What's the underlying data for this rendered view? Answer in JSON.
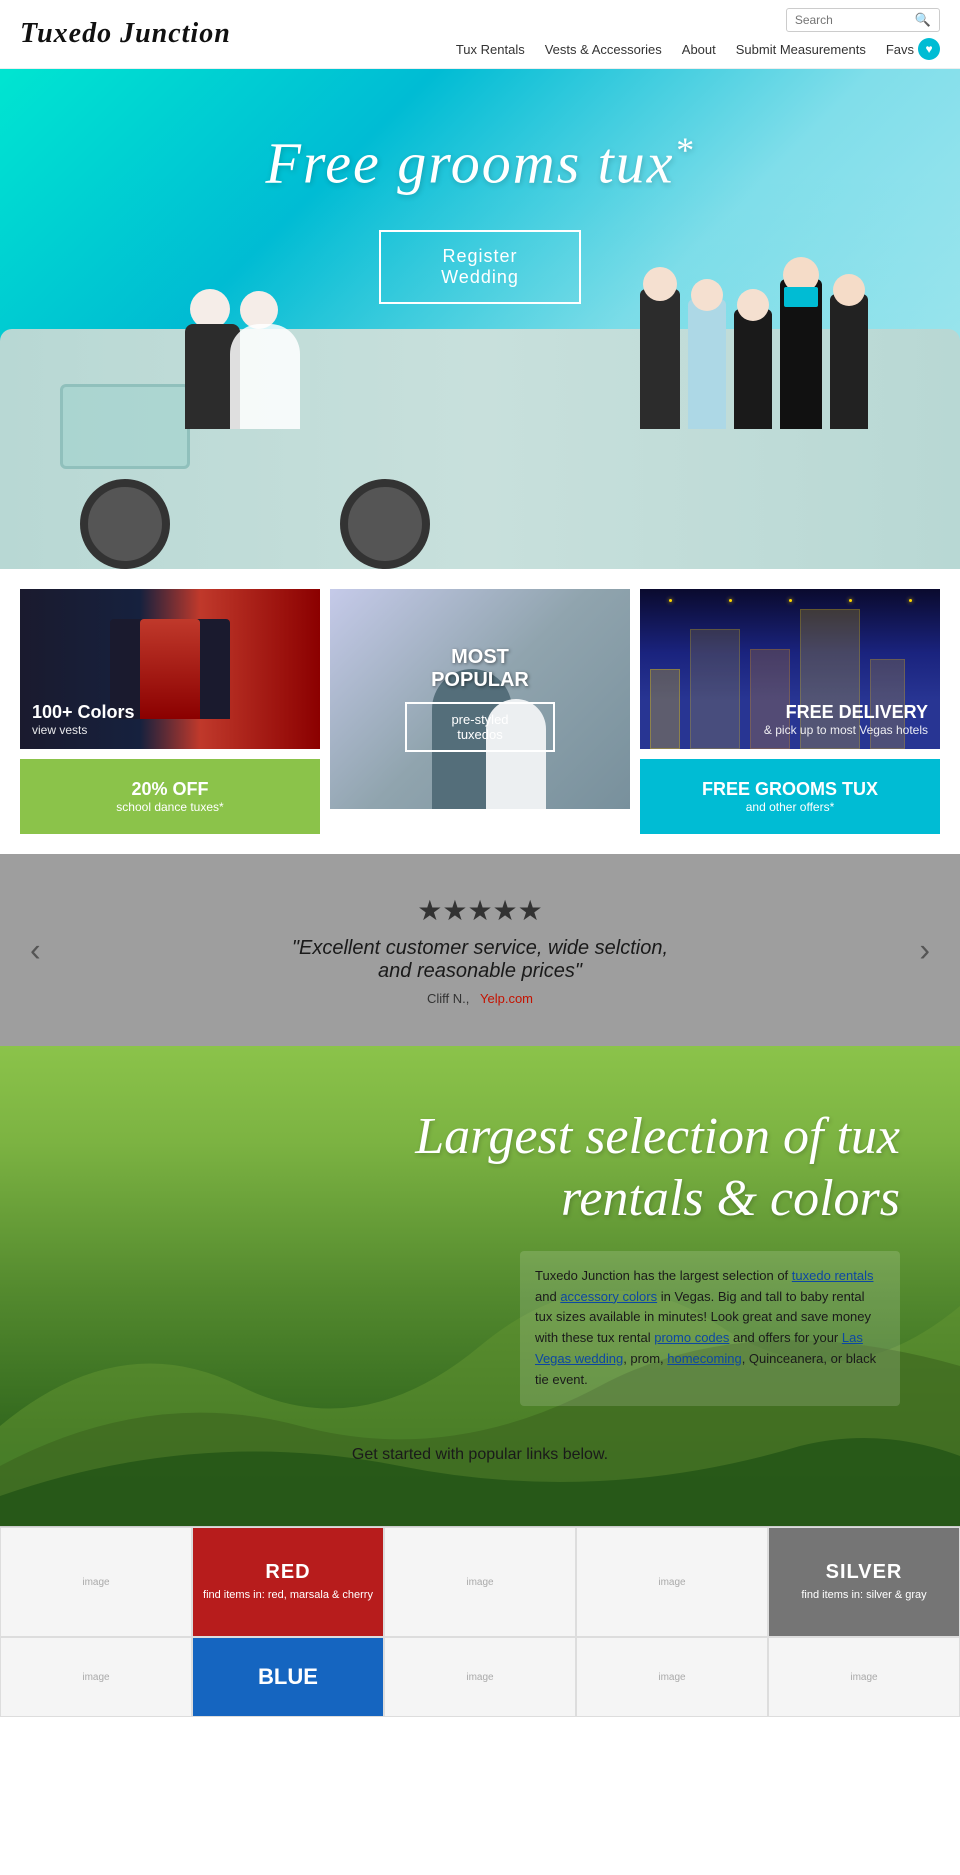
{
  "header": {
    "logo": "Tuxedo Junction",
    "search_placeholder": "Search",
    "nav": [
      {
        "label": "Tux Rentals",
        "href": "#"
      },
      {
        "label": "Vests & Accessories",
        "href": "#"
      },
      {
        "label": "About",
        "href": "#"
      },
      {
        "label": "Submit Measurements",
        "href": "#"
      },
      {
        "label": "Favs",
        "href": "#"
      }
    ]
  },
  "hero": {
    "headline": "Free grooms tux",
    "asterisk": "*",
    "register_button": "Register\nWedding"
  },
  "promo": {
    "col1": {
      "image_label": "100+ Colors",
      "image_sublabel": "view vests",
      "btn_label": "20% OFF",
      "btn_sublabel": "school dance tuxes*"
    },
    "col2": {
      "badge": "MOST POPULAR",
      "btn_label": "pre-styled\ntuxedos"
    },
    "col3": {
      "image_label": "FREE DELIVERY",
      "image_sublabel": "& pick up to most Vegas hotels",
      "btn_label": "FREE GROOMS TUX",
      "btn_sublabel": "and other offers*"
    }
  },
  "testimonial": {
    "stars": "★★★★★",
    "quote": "“Excellent customer service, wide selction,\nand reasonable prices”",
    "attribution": "Cliff N.,",
    "source": "Yelp.com",
    "prev_arrow": "‹",
    "next_arrow": "›"
  },
  "hills": {
    "headline": "Largest selection of tux\nrentals & colors",
    "body_text": "Tuxedo Junction has the largest selection of tuxedo rentals and accessory colors in Vegas. Big and tall to baby rental tux sizes available in minutes! Look great and save money with these tux rental promo codes and offers for your Las Vegas wedding, prom, homecoming, Quinceanera, or black tie event.",
    "links": [
      "tuxedo rentals",
      "accessory colors",
      "promo codes",
      "Las Vegas wedding",
      "homecoming"
    ],
    "footer": "Get started with popular links below."
  },
  "color_grid_row1": [
    {
      "type": "image",
      "label": "image"
    },
    {
      "type": "color",
      "color": "red",
      "title": "RED",
      "subtitle": "find items in: red,\nmarsala & cherry"
    },
    {
      "type": "image",
      "label": "image"
    },
    {
      "type": "image",
      "label": "image"
    },
    {
      "type": "color",
      "color": "silver",
      "title": "SILVER",
      "subtitle": "find items in:\nsilver & gray"
    }
  ],
  "color_grid_row2": [
    {
      "type": "image",
      "label": "image"
    },
    {
      "type": "color",
      "color": "blue",
      "title": "BLUE",
      "subtitle": ""
    },
    {
      "type": "image",
      "label": "image"
    },
    {
      "type": "image",
      "label": "image"
    },
    {
      "type": "image",
      "label": "image"
    }
  ]
}
